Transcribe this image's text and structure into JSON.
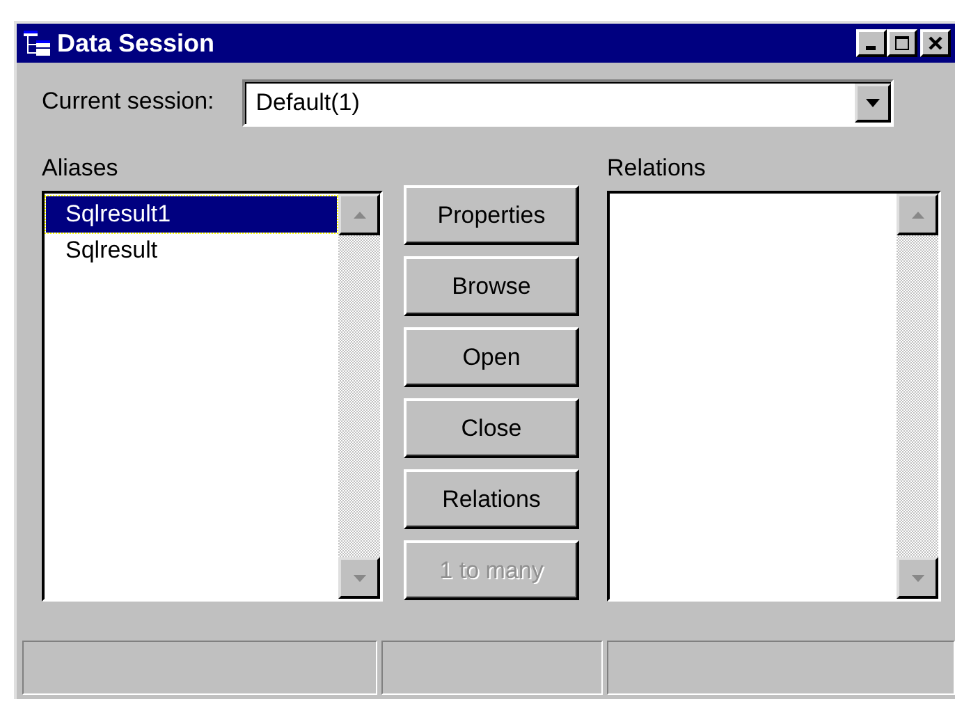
{
  "window": {
    "title": "Data Session"
  },
  "session": {
    "label": "Current session:",
    "value": "Default(1)"
  },
  "aliases": {
    "label": "Aliases",
    "items": [
      {
        "text": "Sqlresult1",
        "selected": true
      },
      {
        "text": "Sqlresult",
        "selected": false
      }
    ]
  },
  "buttons": [
    {
      "label": "Properties",
      "disabled": false
    },
    {
      "label": "Browse",
      "disabled": false
    },
    {
      "label": "Open",
      "disabled": false
    },
    {
      "label": "Close",
      "disabled": false
    },
    {
      "label": "Relations",
      "disabled": false
    },
    {
      "label": "1 to many",
      "disabled": true
    }
  ],
  "relations": {
    "label": "Relations"
  }
}
